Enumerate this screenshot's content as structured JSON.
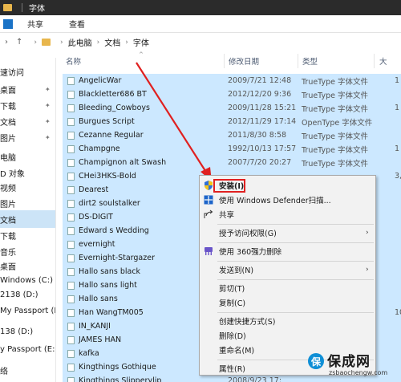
{
  "window": {
    "title": "字体"
  },
  "ribbon": {
    "tabs": [
      "共享",
      "查看"
    ]
  },
  "address": {
    "crumbs": [
      "此电脑",
      "文档",
      "字体"
    ]
  },
  "sidebar": {
    "items": [
      {
        "label": "速访问",
        "pinned": false,
        "selected": false
      },
      {
        "label": "桌面",
        "pinned": true,
        "selected": false
      },
      {
        "label": "下载",
        "pinned": true,
        "selected": false
      },
      {
        "label": "文档",
        "pinned": true,
        "selected": false
      },
      {
        "label": "图片",
        "pinned": true,
        "selected": false
      },
      {
        "label": "电脑",
        "pinned": false,
        "selected": false
      },
      {
        "label": "D 对象",
        "pinned": false,
        "selected": false
      },
      {
        "label": "视频",
        "pinned": false,
        "selected": false
      },
      {
        "label": "图片",
        "pinned": false,
        "selected": false
      },
      {
        "label": "文档",
        "pinned": false,
        "selected": true
      },
      {
        "label": "下载",
        "pinned": false,
        "selected": false
      },
      {
        "label": "音乐",
        "pinned": false,
        "selected": false
      },
      {
        "label": "桌面",
        "pinned": false,
        "selected": false
      },
      {
        "label": "Windows (C:)",
        "pinned": false,
        "selected": false
      },
      {
        "label": "2138 (D:)",
        "pinned": false,
        "selected": false
      },
      {
        "label": "My Passport (E:)",
        "pinned": false,
        "selected": false
      },
      {
        "label": "138 (D:)",
        "pinned": false,
        "selected": false
      },
      {
        "label": "y Passport (E:)",
        "pinned": false,
        "selected": false
      },
      {
        "label": "络",
        "pinned": false,
        "selected": false
      }
    ]
  },
  "columns": {
    "name": "名称",
    "date": "修改日期",
    "type": "类型",
    "size": "大"
  },
  "files": [
    {
      "name": "AngelicWar",
      "date": "2009/7/21 12:48",
      "type": "TrueType 字体文件",
      "size": "1",
      "selected": true
    },
    {
      "name": "Blackletter686 BT",
      "date": "2012/12/20 9:36",
      "type": "TrueType 字体文件",
      "size": "",
      "selected": true
    },
    {
      "name": "Bleeding_Cowboys",
      "date": "2009/11/28 15:21",
      "type": "TrueType 字体文件",
      "size": "1",
      "selected": true
    },
    {
      "name": "Burgues Script",
      "date": "2012/11/29 17:14",
      "type": "OpenType 字体文件",
      "size": "",
      "selected": true
    },
    {
      "name": "Cezanne Regular",
      "date": "2011/8/30 8:58",
      "type": "TrueType 字体文件",
      "size": "",
      "selected": true
    },
    {
      "name": "Champgne",
      "date": "1992/10/13 17:57",
      "type": "TrueType 字体文件",
      "size": "1",
      "selected": true
    },
    {
      "name": "Champignon alt Swash",
      "date": "2007/7/20 20:27",
      "type": "TrueType 字体文件",
      "size": "",
      "selected": true
    },
    {
      "name": "CHei3HKS-Bold",
      "date": "",
      "type": "",
      "size": "3,0",
      "selected": true
    },
    {
      "name": "Dearest",
      "date": "",
      "type": "",
      "size": "",
      "selected": true
    },
    {
      "name": "dirt2 soulstalker",
      "date": "",
      "type": "",
      "size": "",
      "selected": true
    },
    {
      "name": "DS-DIGIT",
      "date": "",
      "type": "",
      "size": "",
      "selected": true
    },
    {
      "name": "Edward s Wedding",
      "date": "",
      "type": "",
      "size": "",
      "selected": true
    },
    {
      "name": "evernight",
      "date": "",
      "type": "",
      "size": "",
      "selected": true
    },
    {
      "name": "Evernight-Stargazer",
      "date": "",
      "type": "",
      "size": "",
      "selected": true
    },
    {
      "name": "Hallo sans black",
      "date": "",
      "type": "",
      "size": "",
      "selected": true
    },
    {
      "name": "Hallo sans light",
      "date": "",
      "type": "",
      "size": "",
      "selected": true
    },
    {
      "name": "Hallo sans",
      "date": "",
      "type": "",
      "size": "",
      "selected": true
    },
    {
      "name": "Han WangTM005",
      "date": "",
      "type": "",
      "size": "10,5",
      "selected": true
    },
    {
      "name": "IN_KANJI",
      "date": "",
      "type": "",
      "size": "",
      "selected": true
    },
    {
      "name": "JAMES HAN",
      "date": "",
      "type": "",
      "size": "",
      "selected": true
    },
    {
      "name": "kafka",
      "date": "",
      "type": "",
      "size": "",
      "selected": true
    },
    {
      "name": "Kingthings Gothique",
      "date": "",
      "type": "",
      "size": "",
      "selected": true
    },
    {
      "name": "Kingthings Slipperylip",
      "date": "2008/9/23 17:",
      "type": "",
      "size": "",
      "selected": true
    }
  ],
  "context_menu": {
    "install": "安装(I)",
    "defender": "使用 Windows Defender扫描...",
    "share": "共享",
    "grant_access": "授予访问权限(G)",
    "force_delete": "使用 360强力删除",
    "send_to": "发送到(N)",
    "cut": "剪切(T)",
    "copy": "复制(C)",
    "create_shortcut": "创建快捷方式(S)",
    "delete": "删除(D)",
    "rename": "重命名(M)",
    "properties": "属性(R)"
  },
  "watermark": {
    "logo": "保",
    "title": "保成网",
    "url": "zsbaochengw.com"
  },
  "colors": {
    "selection": "#cce8ff",
    "annotation": "#e02020",
    "titlebar": "#2b2b2b"
  }
}
